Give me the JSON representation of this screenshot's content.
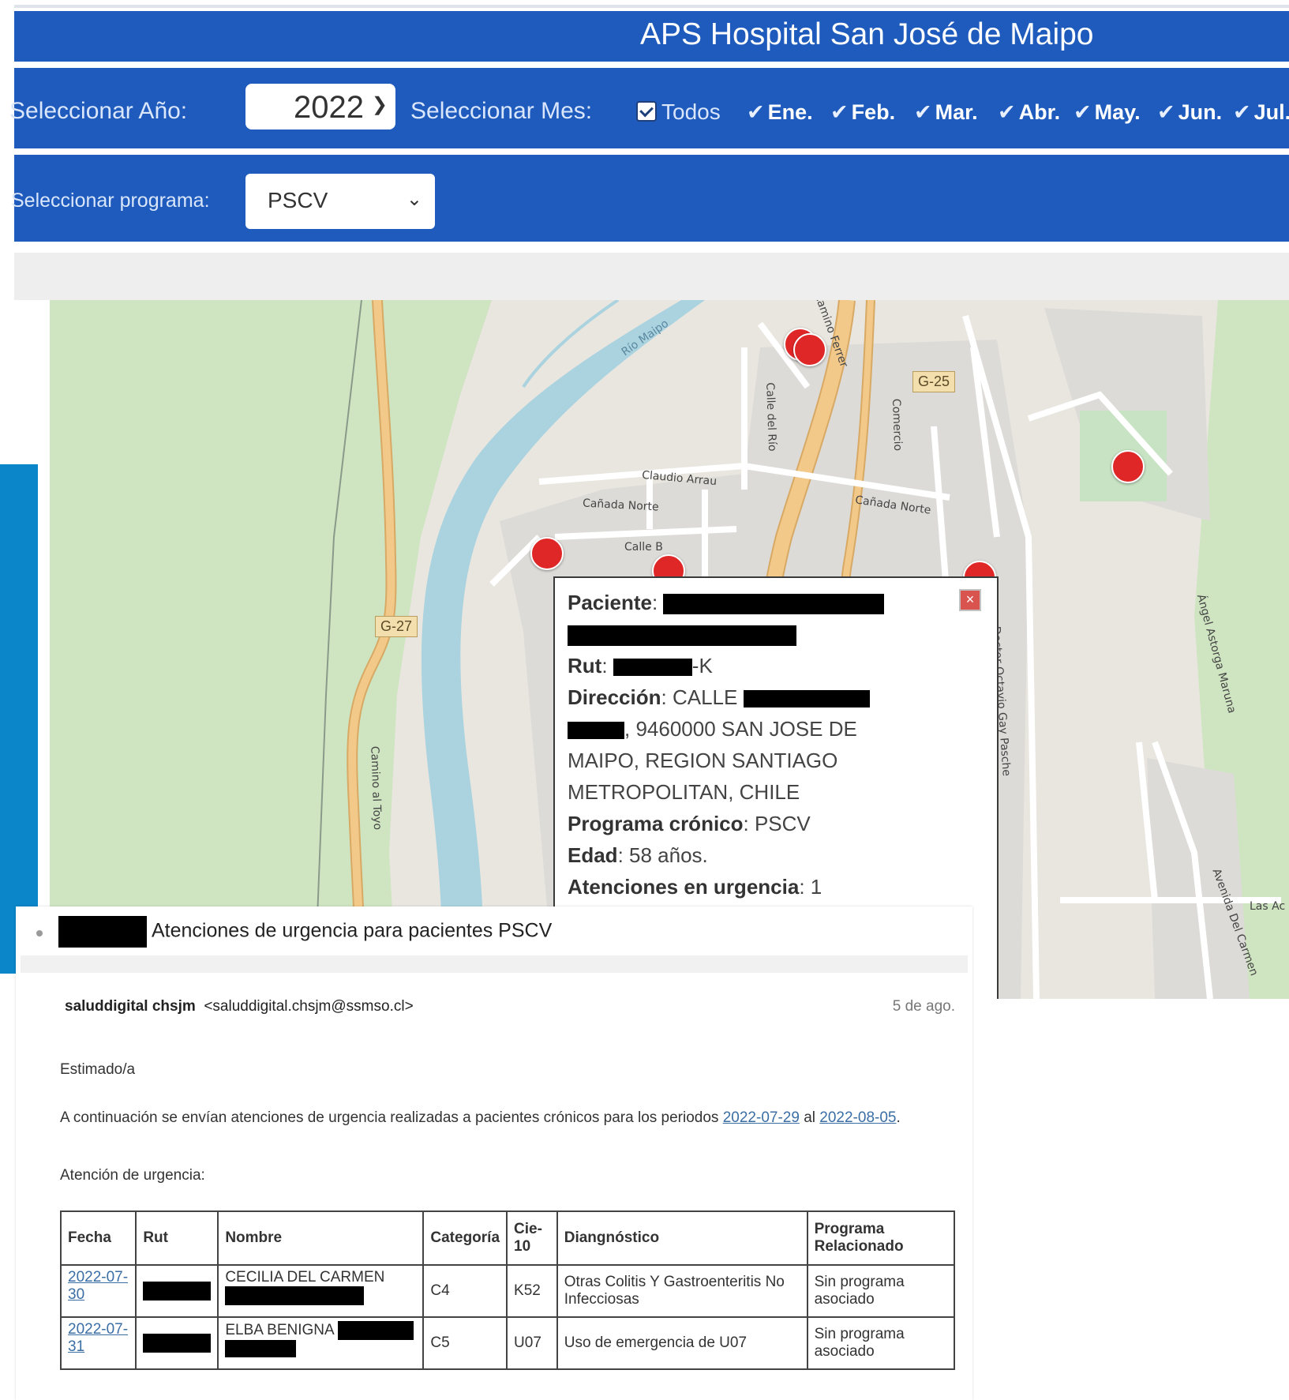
{
  "header": {
    "title": "APS Hospital San José de Maipo",
    "year_label": "Seleccionar Año:",
    "year_value": "2022",
    "month_label": "Seleccionar Mes:",
    "todos_label": "Todos",
    "months": [
      "Ene.",
      "Feb.",
      "Mar.",
      "Abr.",
      "May.",
      "Jun.",
      "Jul."
    ],
    "program_label": "Seleccionar programa:",
    "program_value": "PSCV"
  },
  "map": {
    "road_labels": {
      "g25": "G-25",
      "g27": "G-27",
      "rio_maipo": "Río Maipo",
      "camino_al_toyo": "Camino al Toyo",
      "claudio_arrau": "Claudio Arrau",
      "canada_norte_1": "Cañada Norte",
      "canada_norte_2": "Cañada Norte",
      "calle_b": "Calle B",
      "calle_del_rio": "Calle del Río",
      "comercio": "Comercio",
      "camino_ferrer": "Camino Ferrer",
      "doctor_octavio": "Doctor Octavio Gay Pasche",
      "angel_astorga": "Ángel Astorga Maruna",
      "avenida_del_carmen": "Avenida Del Carmen",
      "las_acacias": "Las Ac"
    },
    "popup": {
      "paciente_label": "Paciente",
      "rut_label": "Rut",
      "rut_suffix": "-K",
      "direccion_label": "Dirección",
      "direccion_start": "CALLE",
      "direccion_line2": ", 9460000 SAN JOSE DE",
      "direccion_line3": "MAIPO, REGION SANTIAGO",
      "direccion_line4": "METROPOLITAN, CHILE",
      "programa_label": "Programa crónico",
      "programa_value": "PSCV",
      "edad_label": "Edad",
      "edad_value": "58 años.",
      "atenciones_label": "Atenciones en urgencia",
      "atenciones_value": "1"
    }
  },
  "email": {
    "subject": "Atenciones de urgencia para pacientes PSCV",
    "sender_name": "saluddigital chsjm",
    "sender_email": "<saluddigital.chsjm@ssmso.cl>",
    "date": "5 de ago.",
    "greeting": "Estimado/a",
    "body_start": "A continuación se envían atenciones de urgencia realizadas a pacientes crónicos para los periodos",
    "date_from": "2022-07-29",
    "connector": "al",
    "date_to": "2022-08-05",
    "section_title": "Atención de urgencia:",
    "table": {
      "headers": [
        "Fecha",
        "Rut",
        "Nombre",
        "Categoría",
        "Cie-10",
        "Diangnóstico",
        "Programa Relacionado"
      ],
      "rows": [
        {
          "fecha": "2022-07-30",
          "nombre": "CECILIA DEL CARMEN",
          "categoria": "C4",
          "cie10": "K52",
          "diagnostico": "Otras Colitis Y Gastroenteritis No Infecciosas",
          "programa": "Sin programa asociado"
        },
        {
          "fecha": "2022-07-31",
          "nombre": "ELBA BENIGNA",
          "categoria": "C5",
          "cie10": "U07",
          "diagnostico": "Uso de emergencia de U07",
          "programa": "Sin programa asociado"
        }
      ]
    }
  },
  "colors": {
    "header_blue": "#1f5bbd",
    "accent_blue": "#0a86c9",
    "marker_red": "#e02727",
    "river_blue": "#aad3df",
    "road_orange": "#f3c98a"
  }
}
